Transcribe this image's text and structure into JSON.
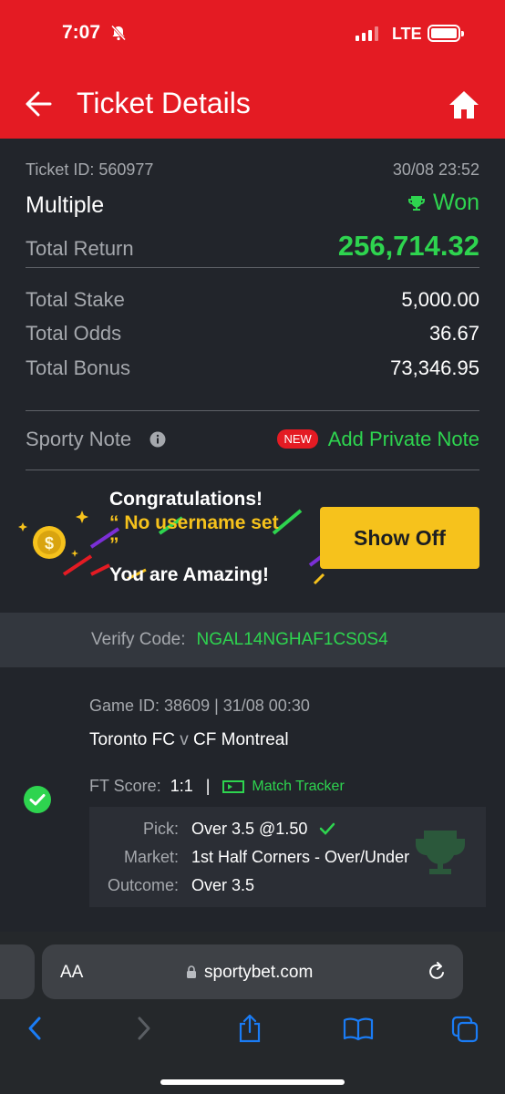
{
  "status_bar": {
    "time": "7:07",
    "network": "LTE"
  },
  "header": {
    "title": "Ticket Details"
  },
  "summary": {
    "ticket_id_label": "Ticket ID: 560977",
    "datetime": "30/08 23:52",
    "bet_type": "Multiple",
    "status": "Won",
    "total_return_label": "Total Return",
    "total_return": "256,714.32",
    "total_stake_label": "Total Stake",
    "total_stake": "5,000.00",
    "total_odds_label": "Total Odds",
    "total_odds": "36.67",
    "total_bonus_label": "Total Bonus",
    "total_bonus": "73,346.95"
  },
  "note": {
    "label": "Sporty Note",
    "badge": "NEW",
    "action": "Add Private Note"
  },
  "promo": {
    "line1": "Congratulations!",
    "quote_open": "“ No username set",
    "quote_close": "”",
    "line3": "You are Amazing!",
    "button": "Show Off"
  },
  "verify": {
    "label": "Verify Code:",
    "code": "NGAL14NGHAF1CS0S4"
  },
  "game": {
    "game_id": "Game ID: 38609 | 31/08 00:30",
    "home": "Toronto FC",
    "vs": "v",
    "away": "CF Montreal",
    "score_label": "FT Score:",
    "score": "1:1",
    "separator": "|",
    "tracker": "Match Tracker",
    "pick_label": "Pick:",
    "pick": "Over 3.5 @1.50",
    "market_label": "Market:",
    "market": "1st Half Corners - Over/Under",
    "outcome_label": "Outcome:",
    "outcome": "Over 3.5"
  },
  "browser": {
    "text_size": "AA",
    "url": "sportybet.com"
  },
  "colors": {
    "brand_red": "#e41b23",
    "win_green": "#2ed44f",
    "accent_yellow": "#f6c21c",
    "ios_blue": "#1a7cf5"
  }
}
